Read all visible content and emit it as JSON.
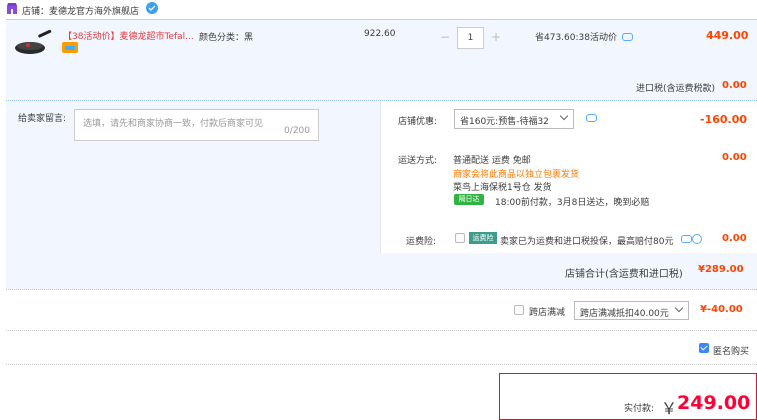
{
  "shop": {
    "label": "店铺：麦德龙官方海外旗舰店",
    "icon": "store-icon",
    "badge_icon": "verified-badge-icon"
  },
  "item": {
    "title": "【38活动价】麦德龙超市Tefal...",
    "sku": "颜色分类：黑",
    "price": "922.60",
    "quantity": "1",
    "saving": "省473.60:38活动价",
    "subtotal": "449.00"
  },
  "tax": {
    "label": "进口税(含运费税款)",
    "value": "0.00"
  },
  "message": {
    "label": "给卖家留言:",
    "placeholder": "选填，请先和商家协商一致，付款后商家可见",
    "count": "0/200"
  },
  "coupon": {
    "label": "店铺优惠:",
    "selected": "省160元:预售-待福32",
    "value": "-160.00"
  },
  "shipping": {
    "label": "运送方式:",
    "method": "普通配送 运费 免邮",
    "note": "商家会将此商品以独立包裹发货",
    "warehouse": "菜鸟上海保税1号仓  发货",
    "badge": "隔日达",
    "eta": "18:00前付款，3月8日送达，晚到必赔",
    "value": "0.00"
  },
  "insurance": {
    "label": "运费险:",
    "badge": "运费险",
    "text": "卖家已为运费和进口税投保，最高赔付80元",
    "value": "0.00"
  },
  "shop_total": {
    "label": "店铺合计(含运费和进口税)",
    "value": "¥289.00"
  },
  "cross_store": {
    "label": "跨店满减",
    "selected": "跨店满减抵扣40.00元",
    "value": "¥-40.00"
  },
  "anonymous": {
    "label": "匿名购买",
    "checked": true
  },
  "payment": {
    "label": "实付款:",
    "currency": "￥",
    "amount": "249.00"
  },
  "colors": {
    "accent": "#ff4400",
    "pay_red": "#ff0036",
    "panel": "#f2f7ff",
    "link_blue": "#3a86ff"
  }
}
